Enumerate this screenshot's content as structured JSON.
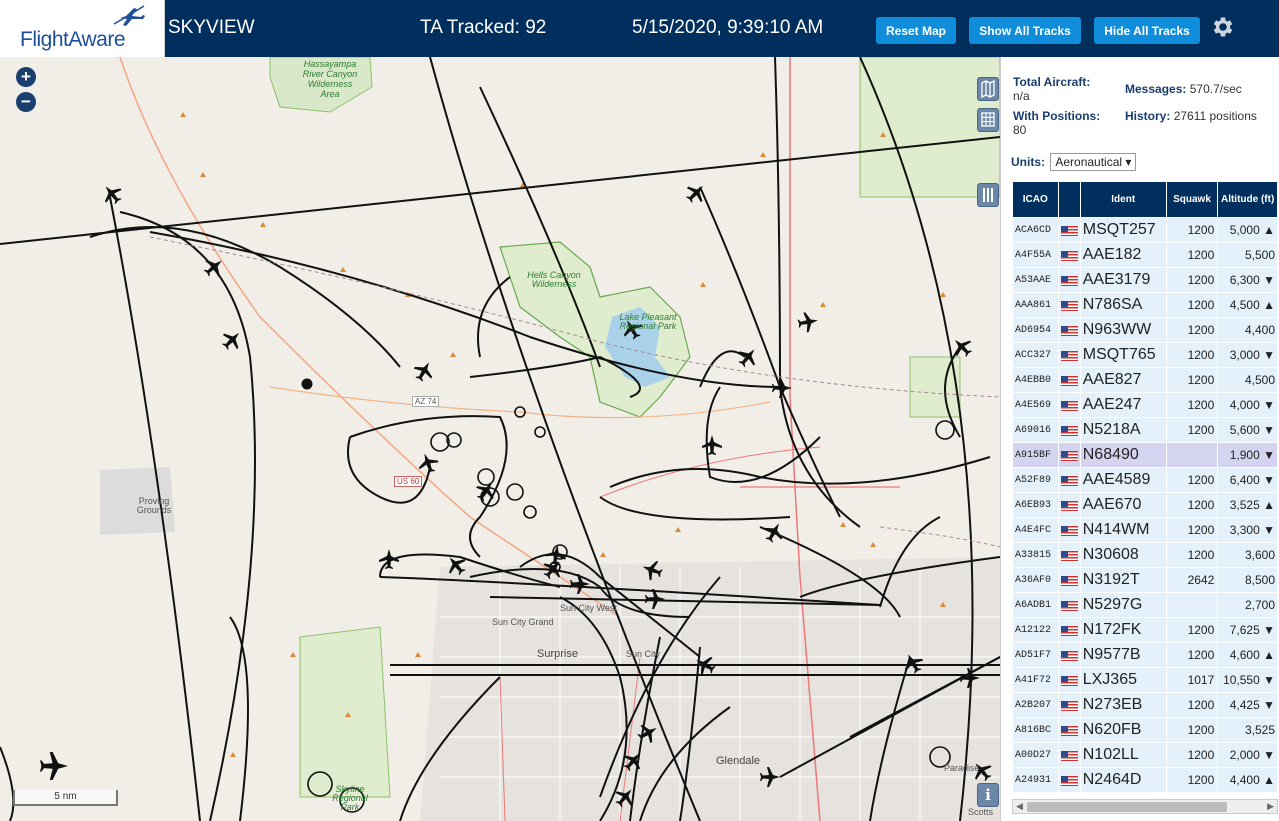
{
  "header": {
    "logo_text": "FlightAware",
    "site_name": "SKYVIEW",
    "ta_tracked": "TA Tracked: 92",
    "datetime": "5/15/2020, 9:39:10 AM",
    "buttons": {
      "reset": "Reset Map",
      "show_all": "Show All Tracks",
      "hide_all": "Hide All Tracks"
    },
    "icons": {
      "gear": "gear-icon",
      "logo": "airplane-logo-icon"
    }
  },
  "map": {
    "zoom_in": "+",
    "zoom_out": "−",
    "scale_label": "5 nm",
    "info_label": "i",
    "labels": {
      "hassayampa": "Hassayampa River Canyon Wilderness Area",
      "hells_canyon": "Hells Canyon Wilderness",
      "lake_pleasant": "Lake Pleasant Regional Park",
      "proving": "Proving Grounds",
      "sun_city_grand": "Sun City Grand",
      "sun_city_west": "Sun City West",
      "surprise": "Surprise",
      "sun_city": "Sun City",
      "glendale": "Glendale",
      "skyline": "Skyline Regional Park",
      "paradise": "Paradise",
      "scottsdale": "Scotts",
      "az74": "AZ 74",
      "us60": "US 60"
    },
    "icons": {
      "layers": "map-layers-icon",
      "grid": "grid-icon",
      "columns": "columns-icon",
      "info": "info-icon",
      "aircraft": "airplane-icon"
    }
  },
  "panel": {
    "total_aircraft_label": "Total Aircraft:",
    "total_aircraft_value": "n/a",
    "with_positions_label": "With Positions:",
    "with_positions_value": "80",
    "messages_label": "Messages:",
    "messages_value": "570.7/sec",
    "history_label": "History:",
    "history_value": "27611 positions",
    "units_label": "Units:",
    "units_value": "Aeronautical",
    "columns": {
      "icao": "ICAO",
      "ident": "Ident",
      "squawk": "Squawk",
      "altitude": "Altitude (ft)"
    },
    "rows": [
      {
        "icao": "ACA6CD",
        "ident": "MSQT257",
        "squawk": "1200",
        "alt": "5,000",
        "trend": "▲",
        "selected": false
      },
      {
        "icao": "A4F55A",
        "ident": "AAE182",
        "squawk": "1200",
        "alt": "5,500",
        "trend": "",
        "selected": false
      },
      {
        "icao": "A53AAE",
        "ident": "AAE3179",
        "squawk": "1200",
        "alt": "6,300",
        "trend": "▼",
        "selected": false
      },
      {
        "icao": "AAA861",
        "ident": "N786SA",
        "squawk": "1200",
        "alt": "4,500",
        "trend": "▲",
        "selected": false
      },
      {
        "icao": "AD6954",
        "ident": "N963WW",
        "squawk": "1200",
        "alt": "4,400",
        "trend": "",
        "selected": false
      },
      {
        "icao": "ACC327",
        "ident": "MSQT765",
        "squawk": "1200",
        "alt": "3,000",
        "trend": "▼",
        "selected": false
      },
      {
        "icao": "A4EBB0",
        "ident": "AAE827",
        "squawk": "1200",
        "alt": "4,500",
        "trend": "",
        "selected": false
      },
      {
        "icao": "A4E569",
        "ident": "AAE247",
        "squawk": "1200",
        "alt": "4,000",
        "trend": "▼",
        "selected": false
      },
      {
        "icao": "A69016",
        "ident": "N5218A",
        "squawk": "1200",
        "alt": "5,600",
        "trend": "▼",
        "selected": false
      },
      {
        "icao": "A915BF",
        "ident": "N68490",
        "squawk": "",
        "alt": "1,900",
        "trend": "▼",
        "selected": true
      },
      {
        "icao": "A52F89",
        "ident": "AAE4589",
        "squawk": "1200",
        "alt": "6,400",
        "trend": "▼",
        "selected": false
      },
      {
        "icao": "A6EB93",
        "ident": "AAE670",
        "squawk": "1200",
        "alt": "3,525",
        "trend": "▲",
        "selected": false
      },
      {
        "icao": "A4E4FC",
        "ident": "N414WM",
        "squawk": "1200",
        "alt": "3,300",
        "trend": "▼",
        "selected": false
      },
      {
        "icao": "A33815",
        "ident": "N30608",
        "squawk": "1200",
        "alt": "3,600",
        "trend": "",
        "selected": false
      },
      {
        "icao": "A36AF0",
        "ident": "N3192T",
        "squawk": "2642",
        "alt": "8,500",
        "trend": "",
        "selected": false
      },
      {
        "icao": "A6ADB1",
        "ident": "N5297G",
        "squawk": "",
        "alt": "2,700",
        "trend": "",
        "selected": false
      },
      {
        "icao": "A12122",
        "ident": "N172FK",
        "squawk": "1200",
        "alt": "7,625",
        "trend": "▼",
        "selected": false
      },
      {
        "icao": "AD51F7",
        "ident": "N9577B",
        "squawk": "1200",
        "alt": "4,600",
        "trend": "▲",
        "selected": false
      },
      {
        "icao": "A41F72",
        "ident": "LXJ365",
        "squawk": "1017",
        "alt": "10,550",
        "trend": "▼",
        "selected": false
      },
      {
        "icao": "A2B207",
        "ident": "N273EB",
        "squawk": "1200",
        "alt": "4,425",
        "trend": "▼",
        "selected": false
      },
      {
        "icao": "A816BC",
        "ident": "N620FB",
        "squawk": "1200",
        "alt": "3,525",
        "trend": "",
        "selected": false
      },
      {
        "icao": "A00D27",
        "ident": "N102LL",
        "squawk": "1200",
        "alt": "2,000",
        "trend": "▼",
        "selected": false
      },
      {
        "icao": "A24931",
        "ident": "N2464D",
        "squawk": "1200",
        "alt": "4,400",
        "trend": "▲",
        "selected": false
      }
    ]
  },
  "colors": {
    "header_bg": "#002f5d",
    "button_bg": "#0f8ddb",
    "row_bg": "#e4f1fa",
    "row_selected": "#d4d4f0",
    "map_bg": "#f1eee8"
  }
}
